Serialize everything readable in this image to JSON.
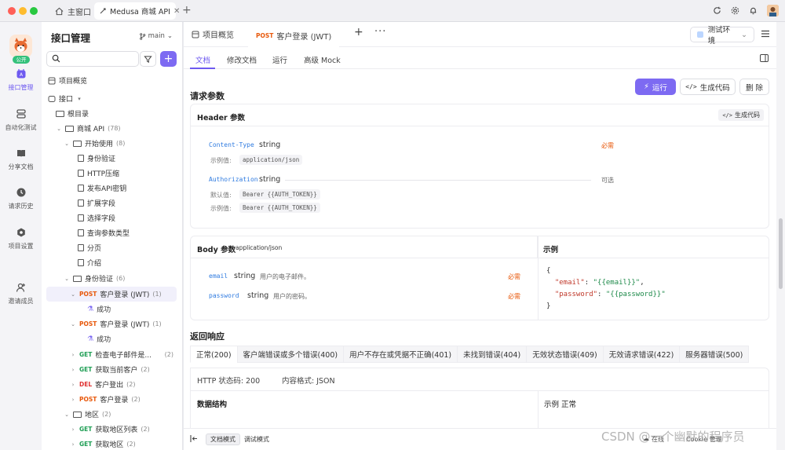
{
  "titlebar": {
    "home_tab": "主窗口",
    "active_tab": "Medusa 商城 API"
  },
  "rail": {
    "badge": "公开",
    "items": [
      {
        "label": "接口管理",
        "icon": "api-icon"
      },
      {
        "label": "自动化测试",
        "icon": "automation-icon"
      },
      {
        "label": "分享文档",
        "icon": "book-icon"
      },
      {
        "label": "请求历史",
        "icon": "clock-icon"
      },
      {
        "label": "项目设置",
        "icon": "gear-icon"
      },
      {
        "label": "邀请成员",
        "icon": "add-user-icon"
      }
    ]
  },
  "tree": {
    "title": "接口管理",
    "branch": "main",
    "overview": "项目概览",
    "interfaces": "接口",
    "root": "根目录",
    "rows": [
      {
        "type": "folder",
        "label": "商城 API",
        "count": "(78)"
      },
      {
        "type": "folder",
        "label": "开始使用",
        "count": "(8)"
      },
      {
        "type": "doc",
        "label": "身份验证"
      },
      {
        "type": "doc",
        "label": "HTTP压缩"
      },
      {
        "type": "doc",
        "label": "发布API密钥"
      },
      {
        "type": "doc",
        "label": "扩展字段"
      },
      {
        "type": "doc",
        "label": "选择字段"
      },
      {
        "type": "doc",
        "label": "查询参数类型"
      },
      {
        "type": "doc",
        "label": "分页"
      },
      {
        "type": "doc",
        "label": "介绍"
      },
      {
        "type": "folder",
        "label": "身份验证",
        "count": "(6)"
      },
      {
        "type": "api",
        "method": "POST",
        "label": "客户登录 (JWT)",
        "count": "(1)"
      },
      {
        "type": "case",
        "label": "成功"
      },
      {
        "type": "api",
        "method": "POST",
        "label": "客户登录 (JWT)",
        "count": "(1)"
      },
      {
        "type": "case",
        "label": "成功"
      },
      {
        "type": "api",
        "method": "GET",
        "label": "检查电子邮件是...",
        "count": "(2)"
      },
      {
        "type": "api",
        "method": "GET",
        "label": "获取当前客户",
        "count": "(2)"
      },
      {
        "type": "api",
        "method": "DEL",
        "label": "客户登出",
        "count": "(2)"
      },
      {
        "type": "api",
        "method": "POST",
        "label": "客户登录",
        "count": "(2)"
      },
      {
        "type": "folder",
        "label": "地区",
        "count": "(2)"
      },
      {
        "type": "api",
        "method": "GET",
        "label": "获取地区列表",
        "count": "(2)"
      },
      {
        "type": "api",
        "method": "GET",
        "label": "获取地区",
        "count": "(2)"
      }
    ]
  },
  "main": {
    "overview_tab": "项目概览",
    "api_tab_method": "POST",
    "api_tab_label": "客户登录 (JWT)",
    "env": "测试环境",
    "sub_tabs": [
      "文档",
      "修改文档",
      "运行",
      "高级 Mock"
    ],
    "request_params": "请求参数",
    "run": "运行",
    "gen_code": "生成代码",
    "delete": "删 除",
    "header_params": "Header 参数",
    "header_gen_code": "生成代码",
    "headers": [
      {
        "name": "Content-Type",
        "type": "string",
        "required": "必需",
        "l1": "示例值:",
        "v1": "application/json"
      },
      {
        "name": "Authorization",
        "type": "string",
        "optional": "可选",
        "l1": "默认值:",
        "v1": "Bearer {{AUTH_TOKEN}}",
        "l2": "示例值:",
        "v2": "Bearer {{AUTH_TOKEN}}"
      }
    ],
    "body_params": "Body 参数",
    "body_type": "application/json",
    "example": "示例",
    "body": [
      {
        "name": "email",
        "type": "string",
        "desc": "用户的电子邮件。",
        "required": "必需"
      },
      {
        "name": "password",
        "type": "string",
        "desc": "用户的密码。",
        "required": "必需"
      }
    ],
    "example_code": {
      "open": "{",
      "k1": "\"email\"",
      "v1": "\"{{email}}\"",
      "k2": "\"password\"",
      "v2": "\"{{password}}\"",
      "close": "}"
    },
    "response": "返回响应",
    "resp_tabs": [
      "正常(200)",
      "客户端错误或多个错误(400)",
      "用户不存在或凭据不正确(401)",
      "未找到错误(404)",
      "无效状态错误(409)",
      "无效请求错误(422)",
      "服务器错误(500)"
    ],
    "http_status": "HTTP 状态码: 200",
    "content_format": "内容格式: JSON",
    "data_structure": "数据结构",
    "example_normal": "示例  正常",
    "modes": [
      "文档模式",
      "调试模式"
    ],
    "online": "在线",
    "cookie": "Cookie 管理"
  },
  "watermark": "CSDN @一个幽默的程序员",
  "colors": {
    "accent": "#7d6af2",
    "post": "#e8590c",
    "get": "#1e9e54",
    "del": "#e03131"
  }
}
